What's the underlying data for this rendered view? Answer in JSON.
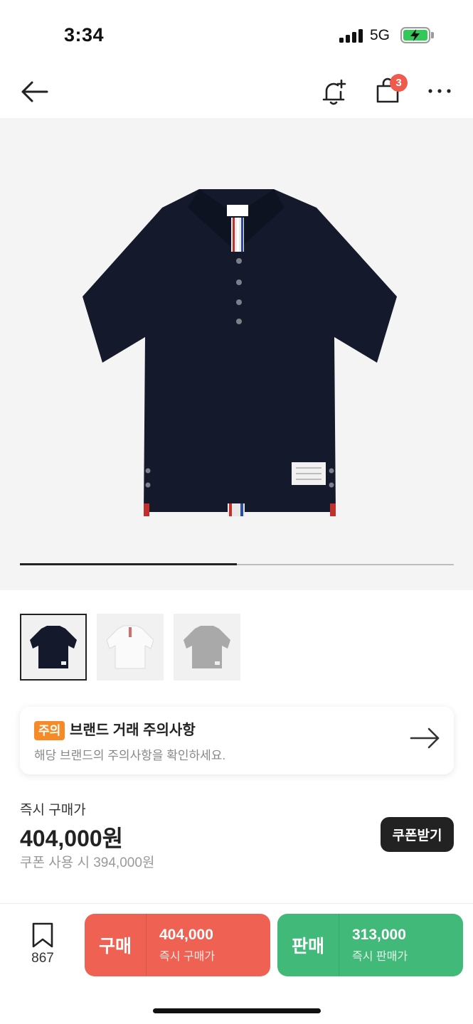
{
  "status_bar": {
    "time": "3:34",
    "network": "5G"
  },
  "nav": {
    "cart_badge": "3"
  },
  "gallery": {
    "progress_fraction": 0.5,
    "thumbnails": [
      "navy",
      "white",
      "grey"
    ]
  },
  "notice": {
    "tag": "주의",
    "title": "브랜드 거래 주의사항",
    "subtitle": "해당 브랜드의 주의사항을 확인하세요."
  },
  "price": {
    "label": "즉시 구매가",
    "value": "404,000원",
    "coupon_note": "쿠폰 사용 시 394,000원",
    "coupon_button": "쿠폰받기"
  },
  "bottom_bar": {
    "bookmark_count": "867",
    "buy": {
      "label": "구매",
      "price": "404,000",
      "sub": "즉시 구매가"
    },
    "sell": {
      "label": "판매",
      "price": "313,000",
      "sub": "즉시 판매가"
    }
  },
  "colors": {
    "buy": "#ef6253",
    "sell": "#41b979",
    "notice_tag": "#f58a26",
    "badge": "#ef5a4f"
  }
}
